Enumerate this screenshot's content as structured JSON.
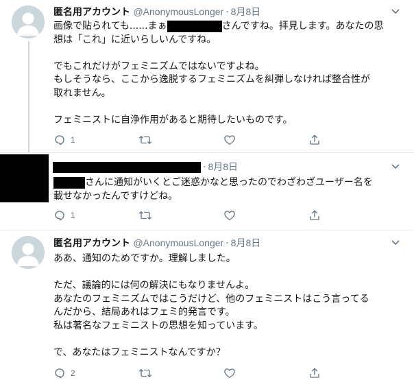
{
  "tweets": [
    {
      "name": "匿名用アカウント",
      "handle": "@AnonymousLonger",
      "date": "8月8日",
      "line1_before": "画像で貼られても......まぁ",
      "line1_after": "さんですね。拝見します。あなたの思",
      "lines": [
        "想は「これ」に近いらしいんですね。",
        "",
        "でもこれだけがフェミニズムではないですよね。",
        "もしそうなら、ここから逸脱するフェミニズムを糾弾しなければ整合性が",
        "取れません。",
        "",
        "フェミニストに自浄作用があると期待したいものです。"
      ],
      "reply_count": "1"
    },
    {
      "date": "8月8日",
      "line1_after": "さんに通知がいくとご迷惑かなと思ったのでわざわざユーザー名を",
      "lines": [
        "載せなかったんですけどね。"
      ],
      "reply_count": "1"
    },
    {
      "name": "匿名用アカウント",
      "handle": "@AnonymousLonger",
      "date": "8月8日",
      "lines": [
        "ああ、通知のためですか。理解しました。",
        "",
        "ただ、議論的には何の解決にもなりませんよ。",
        "あなたのフェミニズムではこうだけど、他のフェミニストはこう言ってる",
        "んだから、結局あれはフェミ的発言です。",
        "私は著名なフェミニストの思想を知っています。",
        "",
        "で、あなたはフェミニストなんですか？"
      ],
      "reply_count": "2"
    }
  ],
  "icons": [
    "reply-icon",
    "retweet-icon",
    "like-icon",
    "share-icon",
    "chevron-down-icon",
    "default-avatar-icon"
  ],
  "colors": {
    "muted": "#657786",
    "thread_line": "#ccd6dd",
    "separator": "#e6ecf0"
  }
}
